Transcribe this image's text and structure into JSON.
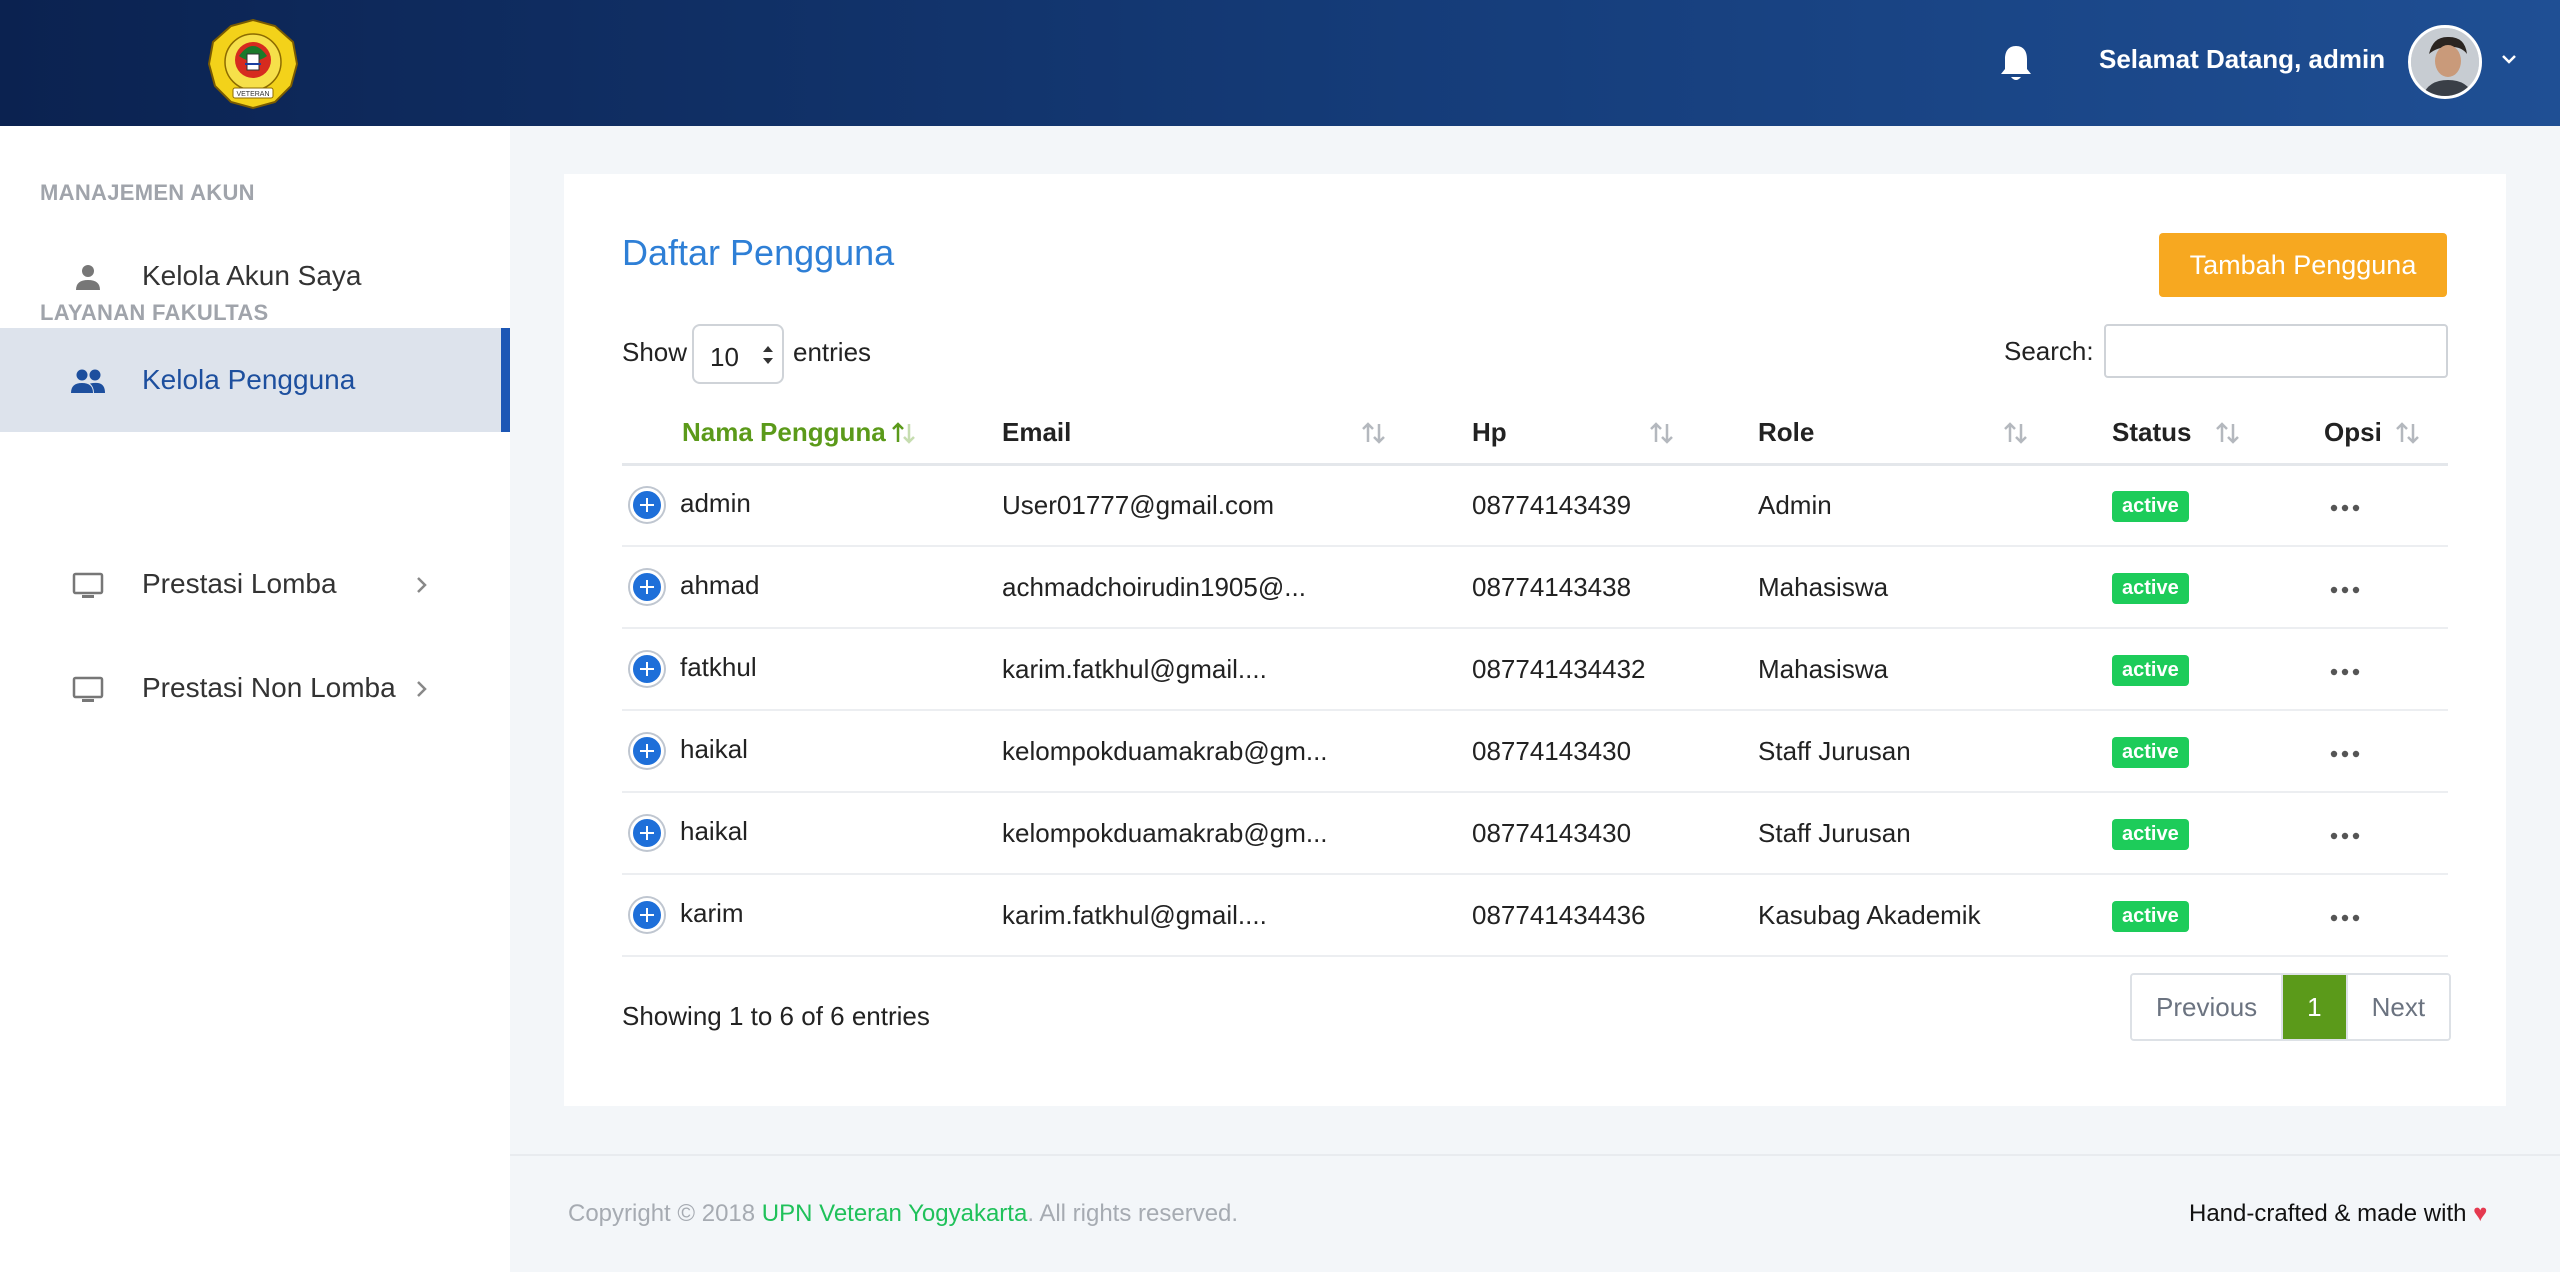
{
  "header": {
    "welcome_text": "Selamat Datang, admin",
    "logo_text": "VETERAN"
  },
  "sidebar": {
    "sections": [
      {
        "title": "MANAJEMEN AKUN"
      },
      {
        "title": "LAYANAN FAKULTAS"
      }
    ],
    "items": [
      {
        "label": "Kelola Akun Saya",
        "icon": "person-icon",
        "active": false
      },
      {
        "label": "Kelola Pengguna",
        "icon": "people-icon",
        "active": true
      },
      {
        "label": "Prestasi Lomba",
        "icon": "monitor-icon",
        "has_submenu": true
      },
      {
        "label": "Prestasi Non Lomba",
        "icon": "monitor-icon",
        "has_submenu": true
      }
    ]
  },
  "main": {
    "title": "Daftar Pengguna",
    "add_button": "Tambah Pengguna",
    "show_label": "Show",
    "page_size": "10",
    "entries_label": "entries",
    "search_label": "Search:",
    "search_value": "",
    "columns": [
      "Nama Pengguna",
      "Email",
      "Hp",
      "Role",
      "Status",
      "Opsi"
    ],
    "sorted_column": "Nama Pengguna",
    "rows": [
      {
        "name": "admin",
        "email": "User01777@gmail.com",
        "hp": "08774143439",
        "role": "Admin",
        "status": "active"
      },
      {
        "name": "ahmad",
        "email": "achmadchoirudin1905@...",
        "hp": "08774143438",
        "role": "Mahasiswa",
        "status": "active"
      },
      {
        "name": "fatkhul",
        "email": "karim.fatkhul@gmail....",
        "hp": "087741434432",
        "role": "Mahasiswa",
        "status": "active"
      },
      {
        "name": "haikal",
        "email": "kelompokduamakrab@gm...",
        "hp": "08774143430",
        "role": "Staff Jurusan",
        "status": "active"
      },
      {
        "name": "haikal",
        "email": "kelompokduamakrab@gm...",
        "hp": "08774143430",
        "role": "Staff Jurusan",
        "status": "active"
      },
      {
        "name": "karim",
        "email": "karim.fatkhul@gmail....",
        "hp": "087741434436",
        "role": "Kasubag Akademik",
        "status": "active"
      }
    ],
    "info_text": "Showing 1 to 6 of 6 entries",
    "pagination": {
      "previous": "Previous",
      "current": "1",
      "next": "Next"
    }
  },
  "footer": {
    "copyright_prefix": "Copyright © 2018 ",
    "brand": "UPN Veteran Yogyakarta",
    "copyright_suffix": ". All rights reserved.",
    "made_with": "Hand-crafted & made with"
  },
  "colors": {
    "header_dark": "#0b2250",
    "header_light": "#1f4f94",
    "accent_blue": "#2e7fd6",
    "add_button": "#f7a820",
    "status_active": "#1dcc5a",
    "sorted_green": "#5b9a1a",
    "brand_green": "#1fc15a",
    "heart": "#e53950"
  }
}
